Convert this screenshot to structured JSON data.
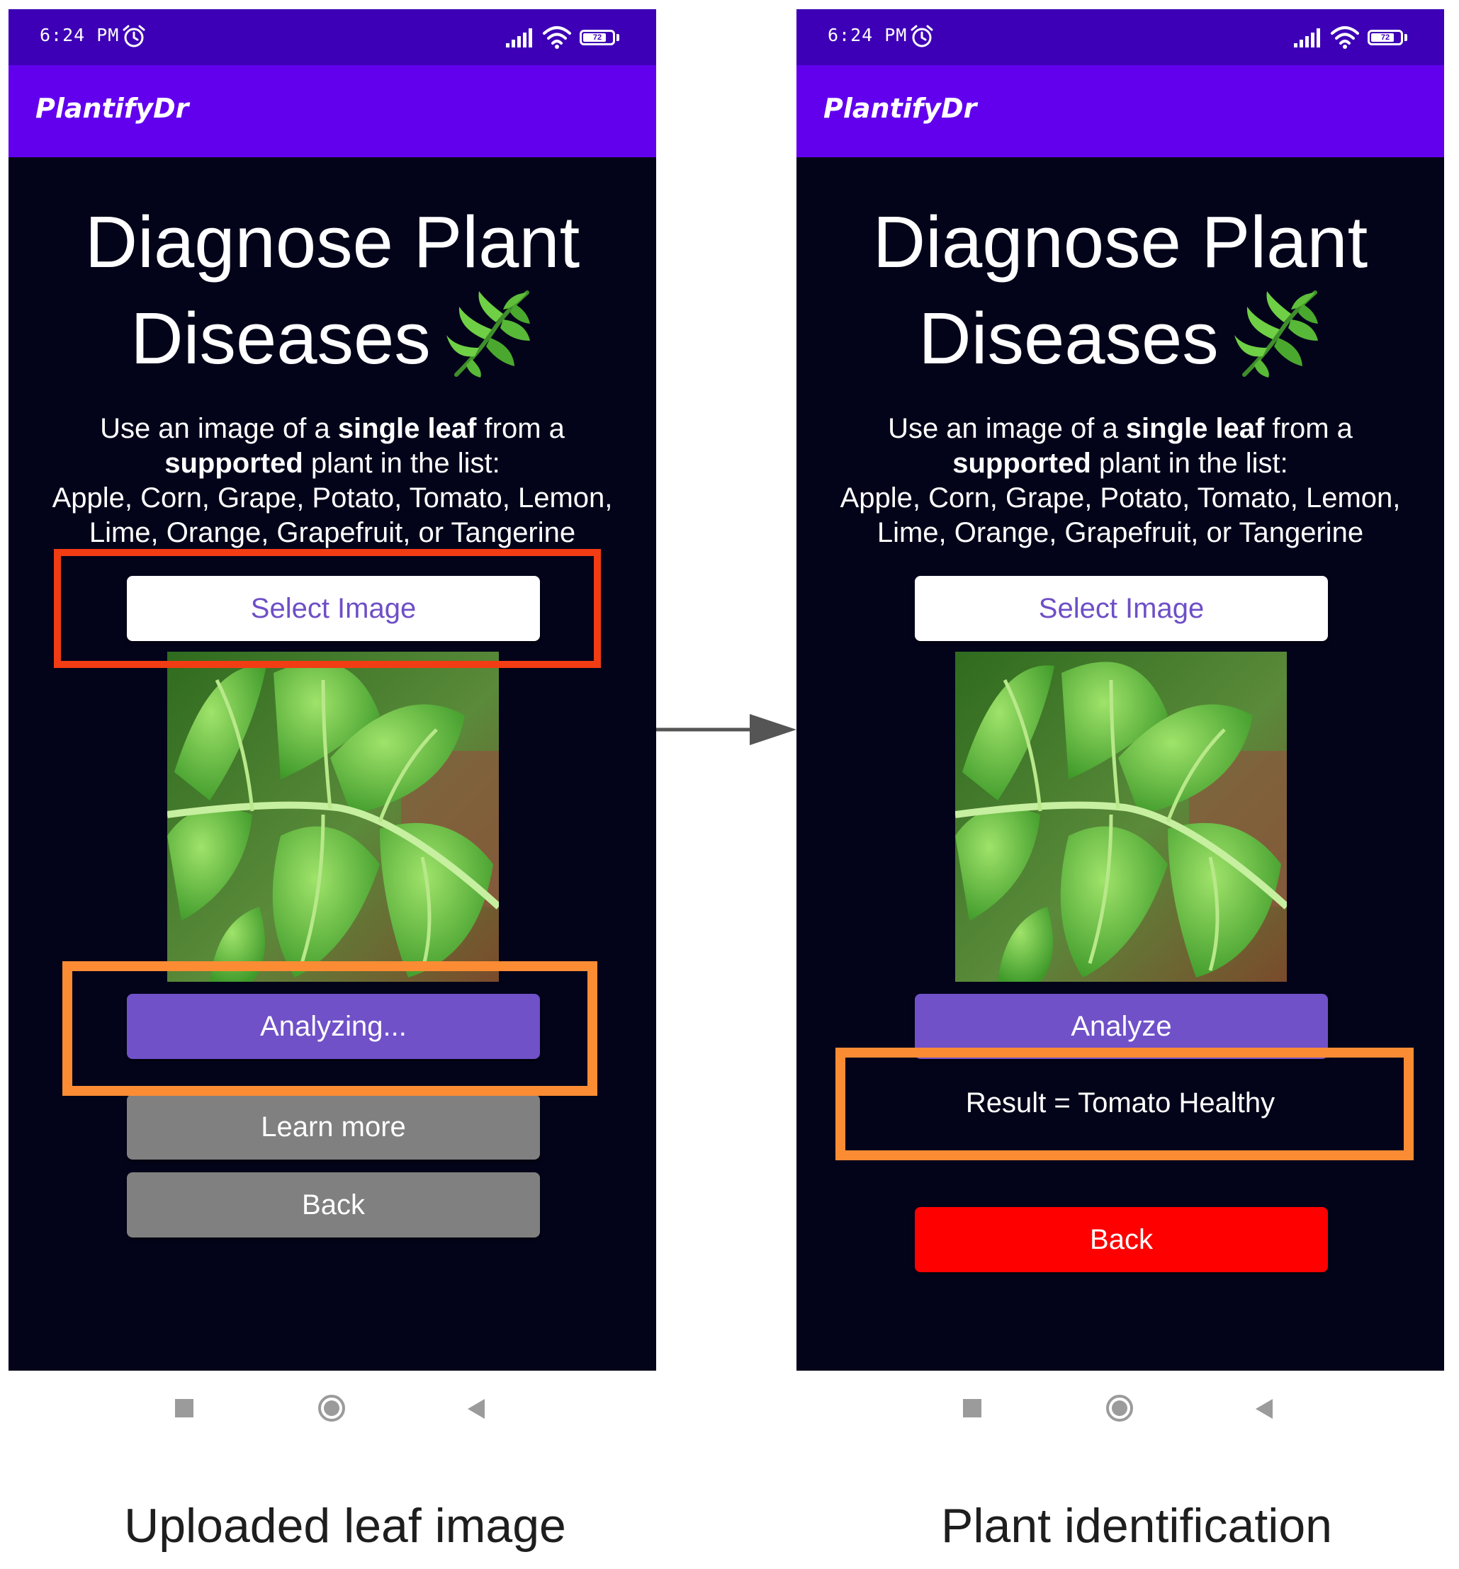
{
  "status_bar": {
    "time": "6:24 PM",
    "battery_level": "72",
    "battery_fraction": 0.72
  },
  "app_bar": {
    "title": "PlantifyDr"
  },
  "headline": {
    "line1": "Diagnose Plant",
    "line2": "Diseases"
  },
  "instructions": {
    "part1": "Use an image of a ",
    "bold1": "single leaf",
    "part2": " from a",
    "bold2": "supported",
    "part3": " plant in the list:",
    "line3": "Apple, Corn, Grape, Potato, Tomato, Lemon,",
    "line4": "Lime, Orange, Grapefruit, or Tangerine"
  },
  "left_screen": {
    "select_image_label": "Select Image",
    "analyze_label": "Analyzing...",
    "learn_more_label": "Learn more",
    "back_label": "Back"
  },
  "right_screen": {
    "select_image_label": "Select Image",
    "analyze_label": "Analyze",
    "result_text": "Result = Tomato Healthy",
    "back_label": "Back"
  },
  "captions": {
    "left": "Uploaded leaf image",
    "right": "Plant identification"
  },
  "icons": {
    "alarm": "alarm-icon",
    "signal": "signal-icon",
    "wifi": "wifi-icon",
    "battery": "battery-icon",
    "leaf": "herb-leaf-icon",
    "nav_recents": "square-icon",
    "nav_home": "circle-icon",
    "nav_back": "triangle-back-icon"
  },
  "colors": {
    "status_bar": "#3d00b6",
    "app_bar": "#6200ee",
    "screen_background": "#03041a",
    "analyze_button": "#7051c8",
    "grey_button": "#808080",
    "back_button_red": "#ff0000",
    "select_label": "#6e4fc6",
    "highlight_red": "#f23c14",
    "highlight_orange": "#fb8c34"
  }
}
